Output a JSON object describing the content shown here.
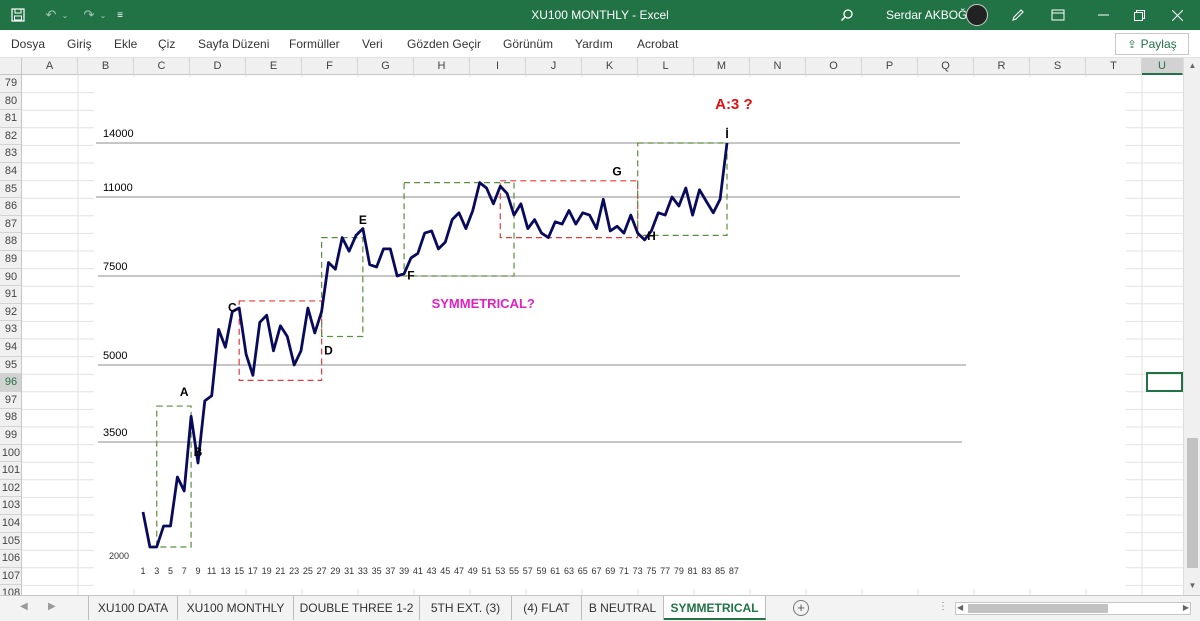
{
  "window": {
    "title": "XU100 MONTHLY  -  Excel",
    "user": "Serdar AKBOĞA",
    "controls": [
      "minimize",
      "restore",
      "close"
    ]
  },
  "colors": {
    "excel_green": "#217346",
    "price_line": "#0a0a5c",
    "box_green": "#5a8f3c",
    "box_red": "#e03b3b",
    "annotation_red": "#e01010",
    "annotation_magenta": "#e020c0"
  },
  "ribbon": {
    "tabs": [
      "Dosya",
      "Giriş",
      "Ekle",
      "Çiz",
      "Sayfa Düzeni",
      "Formüller",
      "Veri",
      "Gözden Geçir",
      "Görünüm",
      "Yardım",
      "Acrobat"
    ],
    "share_label": "Paylaş"
  },
  "grid": {
    "columns": [
      "A",
      "B",
      "C",
      "D",
      "E",
      "F",
      "G",
      "H",
      "I",
      "J",
      "K",
      "L",
      "M",
      "N",
      "O",
      "P",
      "Q",
      "R",
      "S",
      "T",
      "U"
    ],
    "rows": [
      "79",
      "80",
      "81",
      "82",
      "83",
      "84",
      "85",
      "86",
      "87",
      "88",
      "89",
      "90",
      "91",
      "92",
      "93",
      "94",
      "95",
      "96",
      "97",
      "98",
      "99",
      "100",
      "101",
      "102",
      "103",
      "104",
      "105",
      "106",
      "107",
      "108"
    ],
    "selected_column": "U",
    "selected_row": "96"
  },
  "sheets": {
    "tabs": [
      "XU100 DATA",
      "XU100 MONTHLY",
      "DOUBLE THREE 1-2",
      "5TH EXT. (3)",
      "(4) FLAT",
      "B NEUTRAL",
      "SYMMETRICAL"
    ],
    "active": "SYMMETRICAL"
  },
  "chart_data": {
    "type": "line",
    "title": "",
    "xlabel": "",
    "ylabel": "",
    "x_ticks": [
      "1",
      "3",
      "5",
      "7",
      "9",
      "11",
      "13",
      "15",
      "17",
      "19",
      "21",
      "23",
      "25",
      "27",
      "29",
      "31",
      "33",
      "35",
      "37",
      "39",
      "41",
      "43",
      "45",
      "47",
      "49",
      "51",
      "53",
      "55",
      "57",
      "59",
      "61",
      "63",
      "65",
      "67",
      "69",
      "71",
      "73",
      "75",
      "77",
      "79",
      "81",
      "83",
      "85",
      "87"
    ],
    "y_min_label": "2000",
    "levels": [
      {
        "value": 14000,
        "label": "14000"
      },
      {
        "value": 11000,
        "label": "11000"
      },
      {
        "value": 7500,
        "label": "7500"
      },
      {
        "value": 5000,
        "label": "5000"
      },
      {
        "value": 3500,
        "label": "3500"
      }
    ],
    "series": [
      {
        "values": [
          2500,
          2000,
          2000,
          2300,
          2300,
          3000,
          2800,
          4000,
          3200,
          4300,
          4400,
          6000,
          5500,
          6500,
          6600,
          5300,
          4800,
          6200,
          6400,
          5400,
          6100,
          5800,
          5000,
          5400,
          6600,
          5900,
          6500,
          8100,
          7800,
          9200,
          8600,
          9300,
          9600,
          8000,
          7900,
          8700,
          8700,
          7500,
          7600,
          8300,
          8500,
          9400,
          9500,
          8700,
          9000,
          10000,
          10300,
          9600,
          10400,
          11800,
          11500,
          10700,
          11600,
          11200,
          10200,
          10700,
          9600,
          10000,
          9400,
          9200,
          9900,
          9800,
          10400,
          9800,
          10300,
          10200,
          9600,
          10900,
          9500,
          9700,
          9400,
          10200,
          9400,
          9100,
          9500,
          10300,
          10200,
          11000,
          10600,
          11500,
          10200,
          11400,
          10800,
          10300,
          10900,
          14000
        ]
      }
    ],
    "boxes": [
      {
        "color": "green",
        "x": [
          3,
          8
        ],
        "y_range": [
          2000,
          4200
        ]
      },
      {
        "color": "red",
        "x": [
          15,
          27
        ],
        "y_range": [
          4700,
          6800
        ]
      },
      {
        "color": "green",
        "x": [
          27,
          33
        ],
        "y_range": [
          5800,
          9200
        ]
      },
      {
        "color": "green",
        "x": [
          39,
          55
        ],
        "y_range": [
          7500,
          11800
        ]
      },
      {
        "color": "red",
        "x": [
          53,
          73
        ],
        "y_range": [
          9200,
          11900
        ]
      },
      {
        "color": "green",
        "x": [
          73,
          86
        ],
        "y_range": [
          9300,
          14000
        ]
      }
    ],
    "annotations": [
      {
        "text": "A",
        "x": 7,
        "y": 4400
      },
      {
        "text": "B",
        "x": 9,
        "y": 3300
      },
      {
        "text": "C",
        "x": 14,
        "y": 6500
      },
      {
        "text": "D",
        "x": 28,
        "y": 5300
      },
      {
        "text": "E",
        "x": 33,
        "y": 9800
      },
      {
        "text": "F",
        "x": 40,
        "y": 7400
      },
      {
        "text": "G",
        "x": 70,
        "y": 12200
      },
      {
        "text": "H",
        "x": 75,
        "y": 9100
      },
      {
        "text": "İ",
        "x": 86,
        "y": 14200
      },
      {
        "text": "A:3 ?",
        "x": 87,
        "y": 15400,
        "color": "red"
      },
      {
        "text": "SYMMETRICAL?",
        "x": 43,
        "y": 6600,
        "color": "magenta"
      }
    ]
  }
}
